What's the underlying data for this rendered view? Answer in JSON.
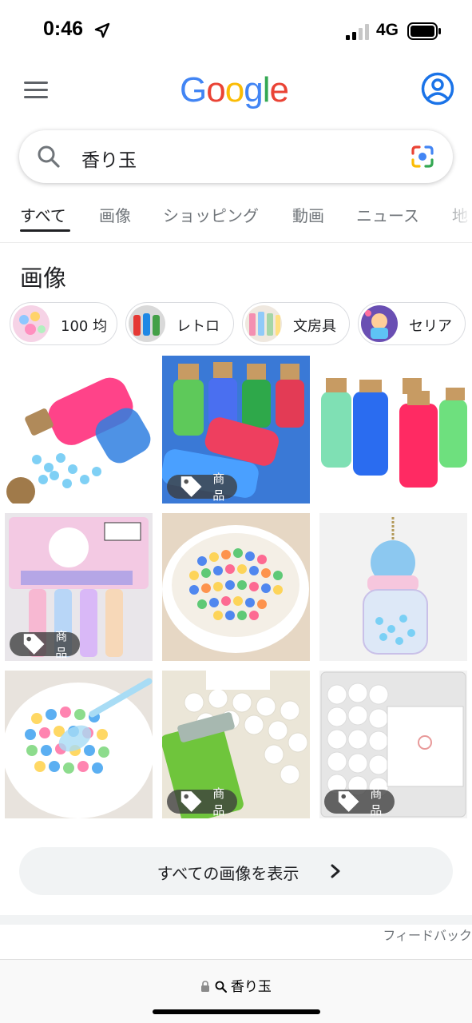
{
  "status_bar": {
    "time": "0:46",
    "network": "4G"
  },
  "header": {
    "logo_letters": [
      {
        "ch": "G",
        "color": "#4285F4"
      },
      {
        "ch": "o",
        "color": "#EA4335"
      },
      {
        "ch": "o",
        "color": "#FBBC05"
      },
      {
        "ch": "g",
        "color": "#4285F4"
      },
      {
        "ch": "l",
        "color": "#34A853"
      },
      {
        "ch": "e",
        "color": "#EA4335"
      }
    ]
  },
  "search": {
    "query": "香り玉"
  },
  "tabs": [
    {
      "label": "すべて",
      "active": true
    },
    {
      "label": "画像"
    },
    {
      "label": "ショッピング"
    },
    {
      "label": "動画"
    },
    {
      "label": "ニュース"
    },
    {
      "label": "地"
    }
  ],
  "images_section": {
    "title": "画像",
    "chips": [
      "100 均",
      "レトロ",
      "文房具",
      "セリア"
    ],
    "tiles": [
      {
        "badge": ""
      },
      {
        "badge": "商品"
      },
      {
        "badge": ""
      },
      {
        "badge": "商品"
      },
      {
        "badge": ""
      },
      {
        "badge": ""
      },
      {
        "badge": ""
      },
      {
        "badge": "商品"
      },
      {
        "badge": "商品"
      }
    ],
    "show_all_label": "すべての画像を表示",
    "feedback_label": "フィードバック"
  },
  "bottom_bar": {
    "url_text": "香り玉"
  },
  "colors": {
    "accent": "#1a73e8",
    "badge_bg": "#3c3c3c"
  }
}
